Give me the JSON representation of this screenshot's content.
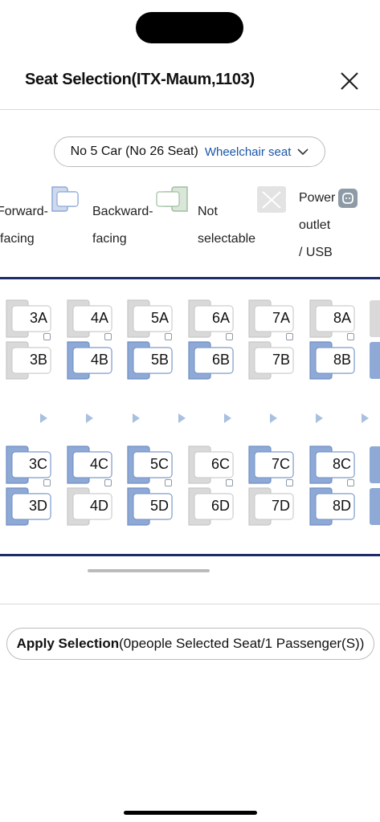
{
  "header": {
    "title": "Seat Selection(ITX-Maum,1103)"
  },
  "car_selector": {
    "car": "No 5 Car (No 26 Seat)",
    "tag": "Wheelchair seat"
  },
  "legend": {
    "forward": [
      "Forward-",
      "facing"
    ],
    "backward": [
      "Backward-",
      "facing"
    ],
    "not_selectable": [
      "Not",
      "selectable"
    ],
    "power": [
      "Power",
      "outlet",
      "/ USB"
    ]
  },
  "seats": {
    "row_a": [
      {
        "label": "3A",
        "status": "unavailable"
      },
      {
        "label": "4A",
        "status": "unavailable"
      },
      {
        "label": "5A",
        "status": "unavailable"
      },
      {
        "label": "6A",
        "status": "unavailable"
      },
      {
        "label": "7A",
        "status": "unavailable"
      },
      {
        "label": "8A",
        "status": "unavailable"
      }
    ],
    "row_b": [
      {
        "label": "3B",
        "status": "unavailable"
      },
      {
        "label": "4B",
        "status": "available"
      },
      {
        "label": "5B",
        "status": "available"
      },
      {
        "label": "6B",
        "status": "available"
      },
      {
        "label": "7B",
        "status": "unavailable"
      },
      {
        "label": "8B",
        "status": "available"
      }
    ],
    "row_c": [
      {
        "label": "3C",
        "status": "available"
      },
      {
        "label": "4C",
        "status": "available"
      },
      {
        "label": "5C",
        "status": "available"
      },
      {
        "label": "6C",
        "status": "unavailable"
      },
      {
        "label": "7C",
        "status": "available"
      },
      {
        "label": "8C",
        "status": "available"
      }
    ],
    "row_d": [
      {
        "label": "3D",
        "status": "available"
      },
      {
        "label": "4D",
        "status": "unavailable"
      },
      {
        "label": "5D",
        "status": "available"
      },
      {
        "label": "6D",
        "status": "unavailable"
      },
      {
        "label": "7D",
        "status": "unavailable"
      },
      {
        "label": "8D",
        "status": "available"
      }
    ]
  },
  "apply": {
    "bold": "Apply Selection",
    "rest": "(0people Selected Seat/1 Passenger(S))"
  },
  "colors": {
    "available": "#8ea9d6",
    "unavailable": "#d9d9d9",
    "accent": "#1a56a8",
    "rail": "#1f2c6b"
  }
}
